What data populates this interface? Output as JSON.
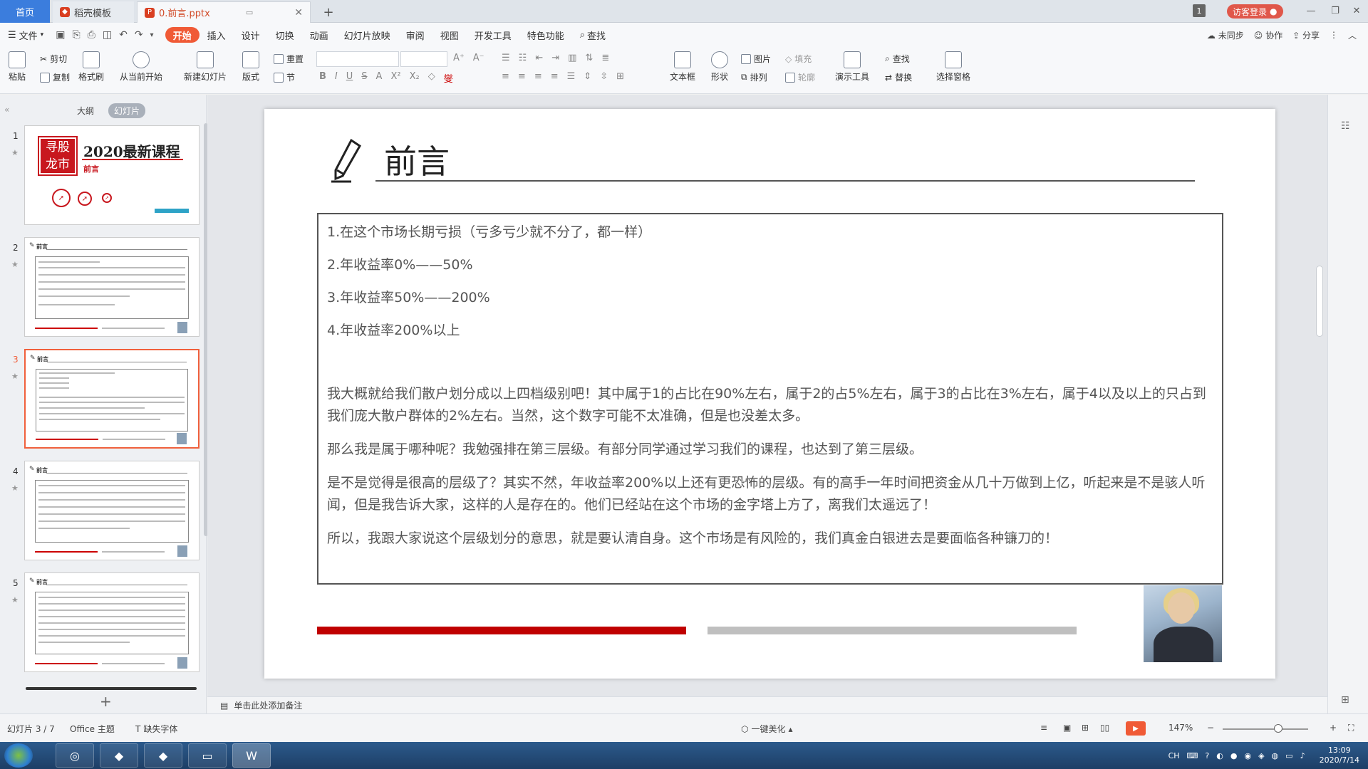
{
  "tabs": {
    "home": "首页",
    "template": "稻壳模板",
    "doc": "0.前言.pptx",
    "add": "+"
  },
  "titlebar": {
    "badge": "1",
    "login": "访客登录"
  },
  "menu": {
    "file": "文件",
    "items": [
      "开始",
      "插入",
      "设计",
      "切换",
      "动画",
      "幻灯片放映",
      "审阅",
      "视图",
      "开发工具",
      "特色功能"
    ],
    "search": "查找",
    "sync": "未同步",
    "collab": "协作",
    "share": "分享"
  },
  "ribbon": {
    "paste": "粘贴",
    "cut": "剪切",
    "copy": "复制",
    "format_painter": "格式刷",
    "from_current": "从当前开始",
    "new_slide": "新建幻灯片",
    "layout": "版式",
    "reset": "重置",
    "section": "节",
    "textbox": "文本框",
    "shape": "形状",
    "picture": "图片",
    "fill": "填充",
    "arrange": "排列",
    "outline": "轮廓",
    "present_tools": "演示工具",
    "find": "查找",
    "replace": "替换",
    "select_pane": "选择窗格"
  },
  "left_panel": {
    "tab_outline": "大纲",
    "tab_slides": "幻灯片",
    "slides": [
      {
        "num": "1",
        "title": "2020最新课程",
        "subtitle": "前言",
        "seal": "寻股龙市"
      },
      {
        "num": "2",
        "title": "前言"
      },
      {
        "num": "3",
        "title": "前言"
      },
      {
        "num": "4",
        "title": "前言"
      },
      {
        "num": "5",
        "title": "前言"
      }
    ]
  },
  "slide": {
    "title": "前言",
    "lines": [
      "1.在这个市场长期亏损（亏多亏少就不分了，都一样）",
      "2.年收益率0%——50%",
      "3.年收益率50%——200%",
      "4.年收益率200%以上"
    ],
    "paragraphs": [
      "我大概就给我们散户划分成以上四档级别吧！其中属于1的占比在90%左右，属于2的占5%左右，属于3的占比在3%左右，属于4以及以上的只占到我们庞大散户群体的2%左右。当然，这个数字可能不太准确，但是也没差太多。",
      "那么我是属于哪种呢？我勉强排在第三层级。有部分同学通过学习我们的课程，也达到了第三层级。",
      "是不是觉得是很高的层级了？其实不然，年收益率200%以上还有更恐怖的层级。有的高手一年时间把资金从几十万做到上亿，听起来是不是骇人听闻，但是我告诉大家，这样的人是存在的。他们已经站在这个市场的金字塔上方了，离我们太遥远了！",
      "所以，我跟大家说这个层级划分的意思，就是要认清自身。这个市场是有风险的，我们真金白银进去是要面临各种镰刀的！"
    ]
  },
  "notes": {
    "placeholder": "单击此处添加备注"
  },
  "status": {
    "slide_info": "幻灯片 3 / 7",
    "theme": "Office 主题",
    "missing_font": "缺失字体",
    "beautify": "一键美化",
    "zoom": "147%"
  },
  "taskbar": {
    "lang": "CH",
    "time": "13:09",
    "date": "2020/7/14"
  },
  "colors": {
    "accent": "#f05a36",
    "brand_red": "#c00000",
    "tab_blue": "#3b7ddd"
  }
}
